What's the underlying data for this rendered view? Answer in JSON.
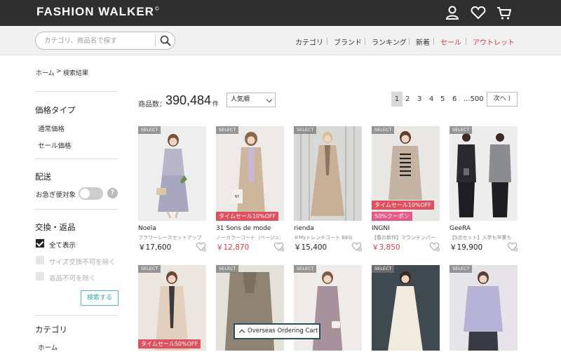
{
  "header": {
    "logo": "FASHION WALKER",
    "logo_mark": "©",
    "icons": [
      "user-icon",
      "heart-icon",
      "cart-icon"
    ]
  },
  "search": {
    "placeholder": "カテゴリ、商品名で探す"
  },
  "nav": [
    {
      "label": "カテゴリ",
      "accent": false
    },
    {
      "label": "ブランド",
      "accent": false
    },
    {
      "label": "ランキング",
      "accent": false
    },
    {
      "label": "新着",
      "accent": false
    },
    {
      "label": "セール",
      "accent": true
    },
    {
      "label": "アウトレット",
      "accent": true
    }
  ],
  "breadcrumb": {
    "home": "ホーム",
    "sep": ">",
    "current": "検索結果"
  },
  "sidebar": {
    "price_type": {
      "title": "価格タイプ",
      "items": [
        "通常価格",
        "セール価格"
      ]
    },
    "delivery": {
      "title": "配送",
      "express": "お急ぎ便対象",
      "help": "?"
    },
    "exchange": {
      "title": "交換・返品",
      "items": [
        "全て表示",
        "サイズ交換不可を除く",
        "返品不可を除く"
      ],
      "button": "検索する"
    },
    "category": {
      "title": "カテゴリ",
      "first": "ホーム"
    }
  },
  "results": {
    "count_label": "商品数：",
    "count": "390,484",
    "count_unit": "件",
    "sort": "人気順",
    "pages": [
      "1",
      "2",
      "3",
      "4",
      "5",
      "6",
      "...500"
    ],
    "next": "次へ"
  },
  "products": [
    {
      "badge": "SELECT",
      "brand": "Noela",
      "name": "フラワーレースセットアップ",
      "price": "￥17,600",
      "on_sale": false,
      "sale_label": "",
      "coupon": ""
    },
    {
      "badge": "SELECT",
      "brand": "31 Sons de mode",
      "name": "ノーカラーコート（ベージュ）",
      "price": "￥12,870",
      "on_sale": true,
      "sale_label": "タイムセール10%OFF",
      "coupon": ""
    },
    {
      "badge": "SELECT",
      "brand": "rienda",
      "name": "＃Myトレンチコート BEG",
      "price": "￥15,400",
      "on_sale": false,
      "sale_label": "",
      "coupon": ""
    },
    {
      "badge": "SELECT",
      "brand": "INGNI",
      "name": "【春の新作】マウンテンパーカー",
      "price": "￥3,850",
      "on_sale": true,
      "sale_label": "タイムセール10%OFF",
      "coupon": "50%クーポン"
    },
    {
      "badge": "SELECT",
      "brand": "GeeRA",
      "name": "【5点セット】入学も卒業も",
      "price": "￥19,900",
      "on_sale": false,
      "sale_label": "",
      "coupon": ""
    },
    {
      "badge": "SELECT",
      "brand": "",
      "name": "",
      "price": "",
      "on_sale": true,
      "sale_label": "タイムセール50%OFF",
      "coupon": ""
    },
    {
      "badge": "SELECT",
      "brand": "",
      "name": "",
      "price": "",
      "on_sale": false,
      "sale_label": "",
      "coupon": ""
    },
    {
      "badge": "SELECT",
      "brand": "",
      "name": "",
      "price": "",
      "on_sale": false,
      "sale_label": "",
      "coupon": ""
    },
    {
      "badge": "SELECT",
      "brand": "",
      "name": "",
      "price": "",
      "on_sale": false,
      "sale_label": "",
      "coupon": ""
    },
    {
      "badge": "SELECT",
      "brand": "",
      "name": "",
      "price": "",
      "on_sale": false,
      "sale_label": "",
      "coupon": ""
    }
  ],
  "floating": {
    "label": "Overseas Ordering Cart"
  },
  "colors": {
    "header_bg": "#2f2f2f",
    "accent_red": "#d83a4a",
    "sale_red": "#e0515f",
    "coupon_pink": "#e85a8a",
    "button_teal": "#3a9fae"
  }
}
